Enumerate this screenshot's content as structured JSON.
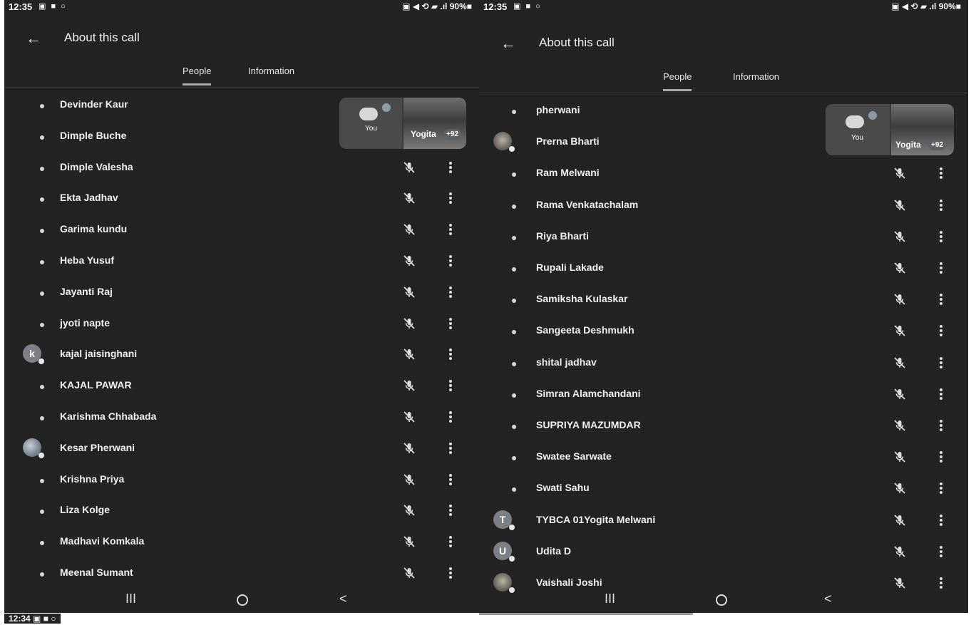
{
  "left_screen": {
    "status": {
      "time": "12:35",
      "notifications": "▣ ■ ○",
      "system": "▣ ◀ ⟲ ▰ .ıl 90%■"
    },
    "header": {
      "title": "About this call",
      "back_icon": "arrow-left"
    },
    "tabs": [
      {
        "label": "People",
        "active": true
      },
      {
        "label": "Information",
        "active": false
      }
    ],
    "pip": {
      "you_label": "You",
      "video_name": "Yogita",
      "count": "+92"
    },
    "participants": [
      {
        "name": "Devinder Kaur",
        "avatar": "dot",
        "controls": false
      },
      {
        "name": "Dimple Buche",
        "avatar": "dot",
        "controls": false
      },
      {
        "name": "Dimple Valesha",
        "avatar": "dot",
        "controls": true
      },
      {
        "name": "Ekta Jadhav",
        "avatar": "dot",
        "controls": true
      },
      {
        "name": "Garima kundu",
        "avatar": "dot",
        "controls": true
      },
      {
        "name": "Heba Yusuf",
        "avatar": "dot",
        "controls": true
      },
      {
        "name": "Jayanti Raj",
        "avatar": "dot",
        "controls": true
      },
      {
        "name": "jyoti napte",
        "avatar": "dot",
        "controls": true
      },
      {
        "name": "kajal jaisinghani",
        "avatar": "letter",
        "initial": "k",
        "controls": true
      },
      {
        "name": "KAJAL PAWAR",
        "avatar": "dot",
        "controls": true
      },
      {
        "name": "Karishma Chhabada",
        "avatar": "dot",
        "controls": true
      },
      {
        "name": "Kesar Pherwani",
        "avatar": "photo",
        "controls": true
      },
      {
        "name": "Krishna Priya",
        "avatar": "dot",
        "controls": true
      },
      {
        "name": "Liza Kolge",
        "avatar": "dot",
        "controls": true
      },
      {
        "name": "Madhavi Komkala",
        "avatar": "dot",
        "controls": true
      },
      {
        "name": "Meenal Sumant",
        "avatar": "dot",
        "controls": true
      }
    ],
    "navbar": {
      "recent": "III",
      "back": "<"
    }
  },
  "right_screen": {
    "status": {
      "time": "12:35",
      "notifications": "▣ ■ ○",
      "system": "▣ ◀ ⟲ ▰ .ıl 90%■"
    },
    "header": {
      "title": "About this call",
      "back_icon": "arrow-left"
    },
    "tabs": [
      {
        "label": "People",
        "active": true
      },
      {
        "label": "Information",
        "active": false
      }
    ],
    "pip": {
      "you_label": "You",
      "video_name": "Yogita",
      "count": "+92"
    },
    "participants": [
      {
        "name": "pherwani",
        "avatar": "dot",
        "controls": false
      },
      {
        "name": "Prerna Bharti",
        "avatar": "photo2",
        "controls": false
      },
      {
        "name": "Ram Melwani",
        "avatar": "dot",
        "controls": true
      },
      {
        "name": "Rama Venkatachalam",
        "avatar": "dot",
        "controls": true
      },
      {
        "name": "Riya Bharti",
        "avatar": "dot",
        "controls": true
      },
      {
        "name": "Rupali Lakade",
        "avatar": "dot",
        "controls": true
      },
      {
        "name": "Samiksha Kulaskar",
        "avatar": "dot",
        "controls": true
      },
      {
        "name": "Sangeeta Deshmukh",
        "avatar": "dot",
        "controls": true
      },
      {
        "name": "shital jadhav",
        "avatar": "dot",
        "controls": true
      },
      {
        "name": "Simran Alamchandani",
        "avatar": "dot",
        "controls": true
      },
      {
        "name": "SUPRIYA MAZUMDAR",
        "avatar": "dot",
        "controls": true
      },
      {
        "name": "Swatee Sarwate",
        "avatar": "dot",
        "controls": true
      },
      {
        "name": "Swati Sahu",
        "avatar": "dot",
        "controls": true
      },
      {
        "name": "TYBCA 01Yogita Melwani",
        "avatar": "letter",
        "initial": "T",
        "controls": true
      },
      {
        "name": "Udita D",
        "avatar": "letter",
        "initial": "U",
        "controls": true
      },
      {
        "name": "Vaishali Joshi",
        "avatar": "photo2",
        "controls": true
      }
    ],
    "navbar": {
      "recent": "III",
      "back": "<"
    }
  },
  "bottom_strip": {
    "time": "12:34 ▣ ■ ○"
  }
}
